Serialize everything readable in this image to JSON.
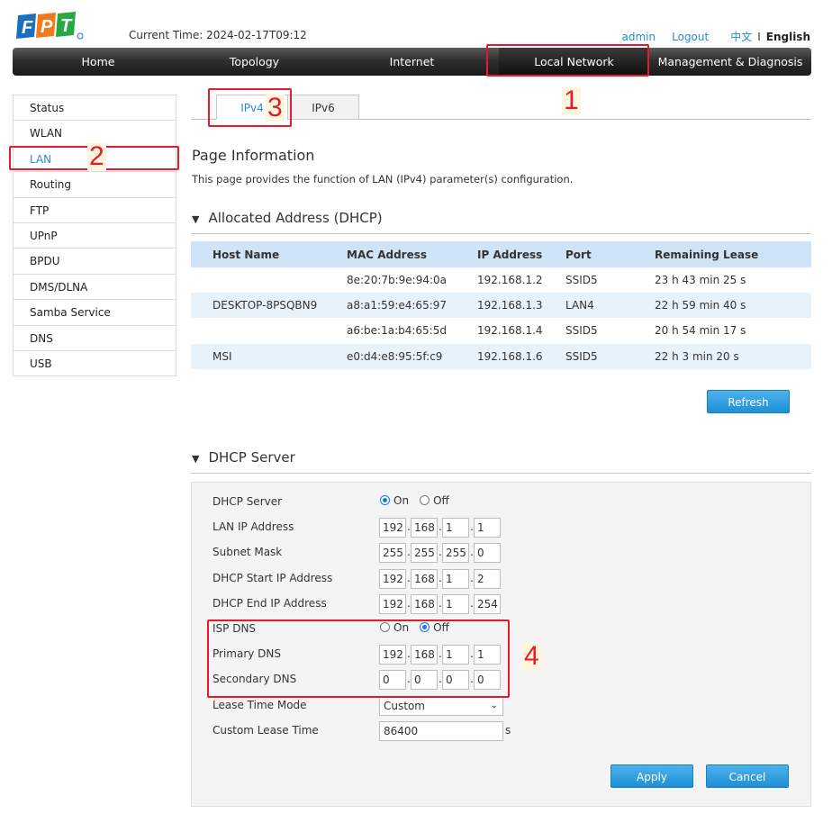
{
  "header": {
    "logo_text": "FPT",
    "current_time_label": "Current Time:",
    "current_time": "2024-02-17T09:12",
    "user": "admin",
    "logout": "Logout",
    "lang_zh": "中文",
    "lang_sep": "I",
    "lang_en": "English"
  },
  "nav": [
    "Home",
    "Topology",
    "Internet",
    "Local Network",
    "Management & Diagnosis"
  ],
  "sidebar": [
    "Status",
    "WLAN",
    "LAN",
    "Routing",
    "FTP",
    "UPnP",
    "BPDU",
    "DMS/DLNA",
    "Samba Service",
    "DNS",
    "USB"
  ],
  "tabs": [
    "IPv4",
    "IPv6"
  ],
  "page": {
    "title": "Page Information",
    "description": "This page provides the function of LAN (IPv4) parameter(s) configuration."
  },
  "dhcp_alloc": {
    "title": "Allocated Address (DHCP)",
    "headers": [
      "Host Name",
      "MAC Address",
      "IP Address",
      "Port",
      "Remaining Lease"
    ],
    "rows": [
      [
        "",
        "8e:20:7b:9e:94:0a",
        "192.168.1.2",
        "SSID5",
        "23 h 43 min 25 s"
      ],
      [
        "DESKTOP-8PSQBN9",
        "a8:a1:59:e4:65:97",
        "192.168.1.3",
        "LAN4",
        "22 h 59 min 40 s"
      ],
      [
        "",
        "a6:be:1a:b4:65:5d",
        "192.168.1.4",
        "SSID5",
        "20 h 54 min 17 s"
      ],
      [
        "MSI",
        "e0:d4:e8:95:5f:c9",
        "192.168.1.6",
        "SSID5",
        "22 h 3 min 20 s"
      ]
    ],
    "refresh": "Refresh"
  },
  "dhcp_server": {
    "title": "DHCP Server",
    "labels": {
      "dhcp_server": "DHCP Server",
      "lan_ip": "LAN IP Address",
      "subnet": "Subnet Mask",
      "start_ip": "DHCP Start IP Address",
      "end_ip": "DHCP End IP Address",
      "isp_dns": "ISP DNS",
      "primary_dns": "Primary DNS",
      "secondary_dns": "Secondary DNS",
      "lease_mode": "Lease Time Mode",
      "custom_lease": "Custom Lease Time"
    },
    "radio_on": "On",
    "radio_off": "Off",
    "dhcp_server_state": "On",
    "isp_dns_state": "Off",
    "lan_ip": [
      "192",
      "168",
      "1",
      "1"
    ],
    "subnet": [
      "255",
      "255",
      "255",
      "0"
    ],
    "start_ip": [
      "192",
      "168",
      "1",
      "2"
    ],
    "end_ip": [
      "192",
      "168",
      "1",
      "254"
    ],
    "primary_dns": [
      "192",
      "168",
      "1",
      "1"
    ],
    "secondary_dns": [
      "0",
      "0",
      "0",
      "0"
    ],
    "lease_mode": "Custom",
    "custom_lease": "86400",
    "lease_unit": "s",
    "apply": "Apply",
    "cancel": "Cancel"
  },
  "annotations": [
    "1",
    "2",
    "3",
    "4"
  ],
  "colors": {
    "accent": "#2a8ccf",
    "annotation_red": "#e8192c",
    "button_blue": "#1e8fd6",
    "table_header": "#cfe4f6"
  }
}
